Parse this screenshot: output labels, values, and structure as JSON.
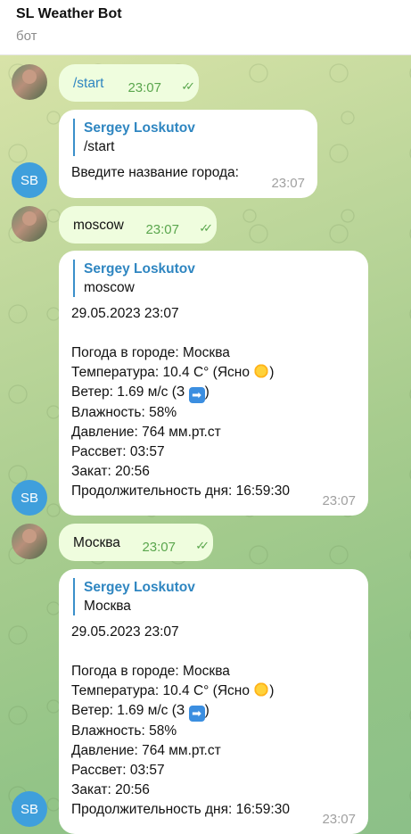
{
  "header": {
    "title": "SL Weather Bot",
    "subtitle": "бот"
  },
  "bot_avatar_initials": "SB",
  "messages": [
    {
      "from": "user",
      "text": "/start",
      "time": "23:07",
      "status": "read"
    },
    {
      "from": "bot",
      "reply_name": "Sergey Loskutov",
      "reply_text": "/start",
      "lines": [
        "Введите название города:"
      ],
      "time": "23:07"
    },
    {
      "from": "user",
      "text": "moscow",
      "time": "23:07",
      "status": "read"
    },
    {
      "from": "bot",
      "reply_name": "Sergey Loskutov",
      "reply_text": "moscow",
      "date": "29.05.2023 23:07",
      "lines": [
        "Погода в городе: Москва",
        "Температура: 10.4 C° (Ясно",
        "Ветер: 1.69 м/с (З",
        "Влажность: 58%",
        "Давление: 764 мм.рт.ст",
        "Рассвет: 03:57",
        "Закат: 20:56",
        "Продолжительность дня: 16:59:30"
      ],
      "time": "23:07"
    },
    {
      "from": "user",
      "text": "Москва",
      "time": "23:07",
      "status": "read"
    },
    {
      "from": "bot",
      "reply_name": "Sergey Loskutov",
      "reply_text": "Москва",
      "date": "29.05.2023 23:07",
      "lines": [
        "Погода в городе: Москва",
        "Температура: 10.4 C° (Ясно",
        "Ветер: 1.69 м/с (З",
        "Влажность: 58%",
        "Давление: 764 мм.рт.ст",
        "Рассвет: 03:57",
        "Закат: 20:56",
        "Продолжительность дня: 16:59:30"
      ],
      "time": "23:07"
    }
  ],
  "icons": {
    "read_status": "double-check-icon",
    "sun": "sun-emoji-icon",
    "wind_direction": "right-arrow-emoji-icon"
  },
  "colors": {
    "outgoing_bubble": "#effdde",
    "incoming_bubble": "#ffffff",
    "accent": "#2f86c1",
    "check": "#5aa64d",
    "bot_avatar": "#3f9fdc"
  }
}
